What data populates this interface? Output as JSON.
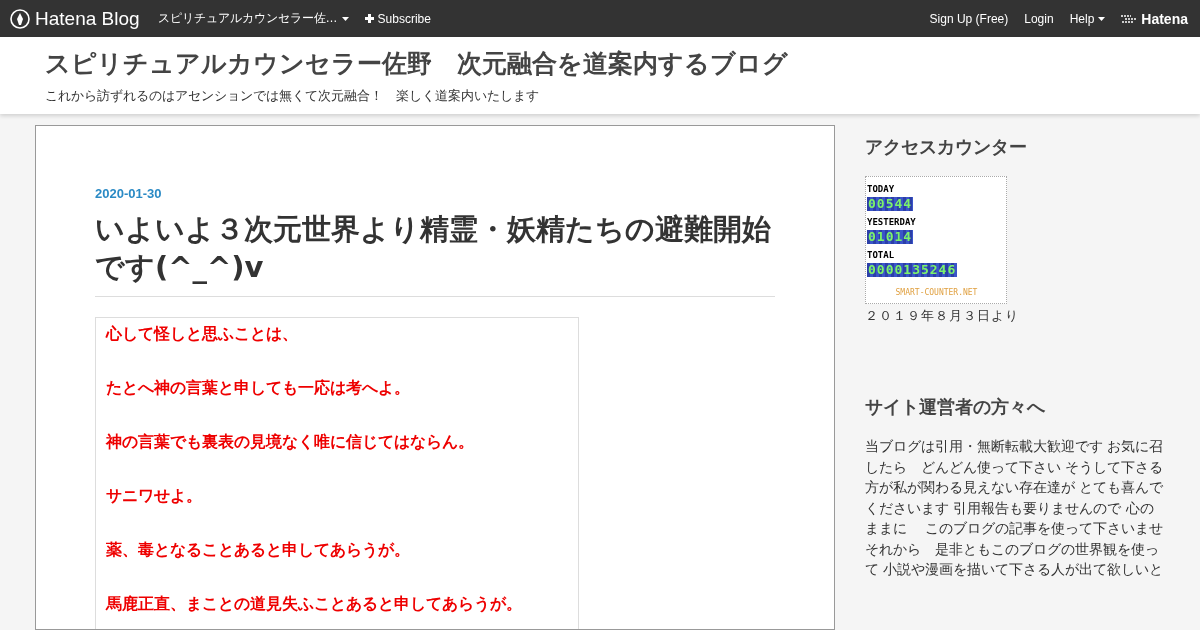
{
  "topbar": {
    "brand": "Hatena Blog",
    "blog_menu": "スピリチュアルカウンセラー佐…",
    "subscribe": "Subscribe",
    "links": [
      {
        "label": "Sign Up (Free)",
        "kind": "link"
      },
      {
        "label": "Login",
        "kind": "link"
      },
      {
        "label": "Help",
        "kind": "menu"
      }
    ],
    "hatena": "Hatena"
  },
  "header": {
    "title": "スピリチュアルカウンセラー佐野　次元融合を道案内するブログ",
    "tagline": "これから訪ずれるのはアセンションでは無くて次元融合！　楽しく道案内いたします"
  },
  "article": {
    "date": "2020-01-30",
    "title": "いよいよ３次元世界より精霊・妖精たちの避難開始です(^_^)v",
    "body": [
      "心して怪しと思ふことは、",
      "たとへ神の言葉と申しても一応は考へよ。",
      "神の言葉でも裏表の見境なく唯に信じてはならん。",
      "サニワせよ。",
      "薬、毒となることあると申してあらうが。",
      "馬鹿正直、まことの道見失ふことあると申してあらうが。"
    ]
  },
  "sidebar": {
    "sections": [
      {
        "kind": "counter",
        "title": "アクセスカウンター",
        "rows": [
          {
            "label": "TODAY",
            "digits": "00544"
          },
          {
            "label": "YESTERDAY",
            "digits": "01014"
          },
          {
            "label": "TOTAL",
            "digits": "0000135246"
          }
        ],
        "credit": "SMART-COUNTER.NET",
        "note": "２０１９年８月３日より"
      },
      {
        "kind": "text",
        "title": "サイト運営者の方々へ",
        "lines": [
          "当ブログは引用・無断転載大歓迎です お気に召",
          "したら　どんどん使って下さい そうして下さる",
          "方が私が関わる見えない存在達が とても喜んで",
          "くださいます 引用報告も要りませんので 心の",
          "ままに　 このブログの記事を使って下さいませ",
          "それから　是非ともこのブログの世界観を使っ",
          "て 小説や漫画を描いて下さる人が出て欲しいと"
        ]
      }
    ]
  }
}
